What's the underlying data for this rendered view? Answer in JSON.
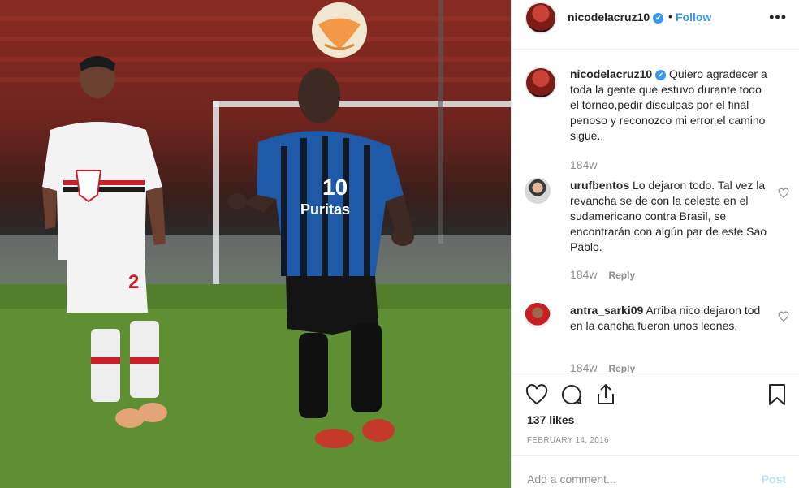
{
  "post": {
    "username": "nicodelacruz10",
    "verified_glyph": "✔",
    "separator": "•",
    "follow_label": "Follow",
    "more_glyph": "•••",
    "photo_description_icon": "soccer-photo"
  },
  "caption": {
    "username": "nicodelacruz10",
    "text": "Quiero agradecer a toda la gente que estuvo durante todo el torneo,pedir disculpas por el final penoso y reconozco mi error,el camino sigue..",
    "time": "184w"
  },
  "comments": [
    {
      "username": "urufbentos",
      "text": "Lo dejaron todo. Tal vez la revancha se de con la celeste en el sudamericano contra Brasil, se encontrarán con algún par de este Sao Pablo.",
      "time": "184w",
      "reply_label": "Reply"
    },
    {
      "username": "antra_sarki09",
      "text": "Arriba nico dejaron tod en la cancha fueron unos leones.",
      "time": "184w",
      "reply_label": "Reply"
    }
  ],
  "stats": {
    "likes": "137 likes",
    "date": "FEBRUARY 14, 2016"
  },
  "composer": {
    "placeholder": "Add a comment...",
    "post_label": "Post"
  },
  "photo": {
    "jersey_number_main": "10",
    "jersey_sponsor": "Puritas",
    "jersey_number_left": "2"
  },
  "colors": {
    "link_blue": "#3897f0",
    "post_disabled": "#b2dffc",
    "muted": "#8e8e8e"
  }
}
